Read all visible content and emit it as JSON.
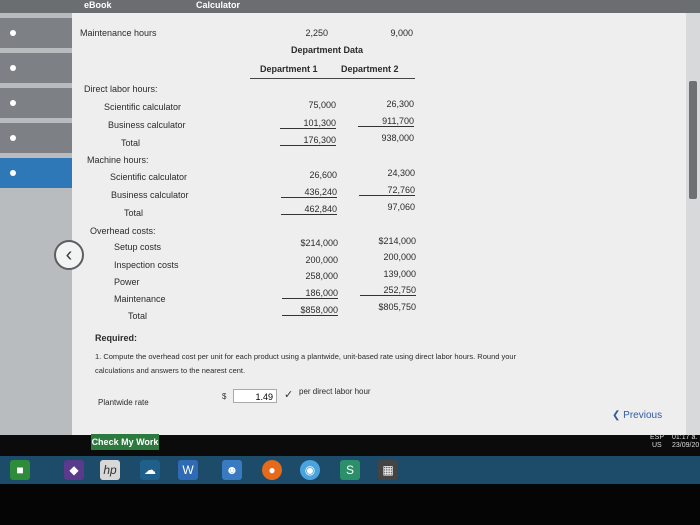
{
  "tabs": {
    "ebook": "eBook",
    "calculator": "Calculator"
  },
  "maintenance_hours": {
    "label": "Maintenance hours",
    "dept1": "2,250",
    "dept2": "9,000"
  },
  "dept_data": {
    "title": "Department Data",
    "col1": "Department 1",
    "col2": "Department 2"
  },
  "direct_labor": {
    "label": "Direct labor hours:",
    "rows": [
      {
        "label": "Scientific calculator",
        "d1": "75,000",
        "d2": "26,300"
      },
      {
        "label": "Business calculator",
        "d1": "101,300",
        "d2": "911,700"
      },
      {
        "label": "Total",
        "d1": "176,300",
        "d2": "938,000"
      }
    ]
  },
  "machine_hours": {
    "label": "Machine hours:",
    "rows": [
      {
        "label": "Scientific calculator",
        "d1": "26,600",
        "d2": "24,300"
      },
      {
        "label": "Business calculator",
        "d1": "436,240",
        "d2": "72,760"
      },
      {
        "label": "Total",
        "d1": "462,840",
        "d2": "97,060"
      }
    ]
  },
  "overhead": {
    "label": "Overhead costs:",
    "rows": [
      {
        "label": "Setup costs",
        "d1": "$214,000",
        "d2": "$214,000"
      },
      {
        "label": "Inspection costs",
        "d1": "200,000",
        "d2": "200,000"
      },
      {
        "label": "Power",
        "d1": "258,000",
        "d2": "139,000"
      },
      {
        "label": "Maintenance",
        "d1": "186,000",
        "d2": "252,750"
      },
      {
        "label": "Total",
        "d1": "$858,000",
        "d2": "$805,750"
      }
    ]
  },
  "required": {
    "label": "Required:",
    "question_line1": "1. Compute the overhead cost per unit for each product using a plantwide, unit-based rate using direct labor hours. Round your",
    "question_line2": "calculations and answers to the nearest cent."
  },
  "answer": {
    "label": "Plantwide rate",
    "currency": "$",
    "value": "1.49",
    "unit": "per direct labor hour"
  },
  "buttons": {
    "check_my_work": "Check My Work",
    "previous": "Previous"
  },
  "tray": {
    "lang1": "ESP",
    "lang2": "US",
    "time": "01:17 a.",
    "date": "23/09/20"
  }
}
